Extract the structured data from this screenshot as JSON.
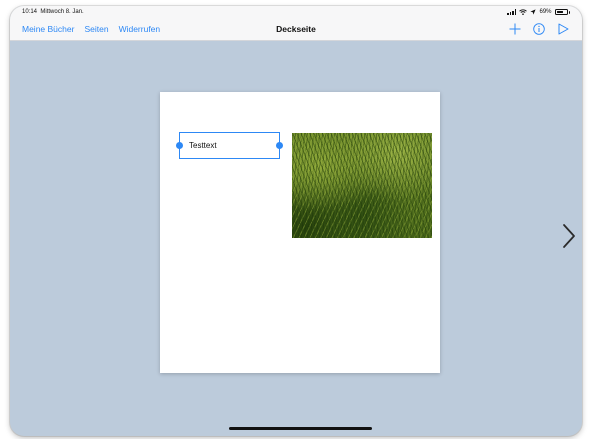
{
  "status_bar": {
    "time": "10:14",
    "date": "Mittwoch 8. Jan.",
    "battery": "69%",
    "battery_level": 0.69
  },
  "nav_bar": {
    "left_items": [
      "Meine Bücher",
      "Seiten",
      "Widerrufen"
    ],
    "title": "Deckseite",
    "right_icons": [
      "plus-icon",
      "info-icon",
      "play-icon"
    ]
  },
  "page": {
    "text_box": {
      "text": "Testtext"
    },
    "image": {
      "content": "grass-photo"
    }
  },
  "navigation": {
    "next_icon": "chevron-right-icon"
  },
  "colors": {
    "accent": "#2d88f5",
    "canvas_background": "#bccbdb",
    "toolbar_background": "#f7f7f8"
  }
}
